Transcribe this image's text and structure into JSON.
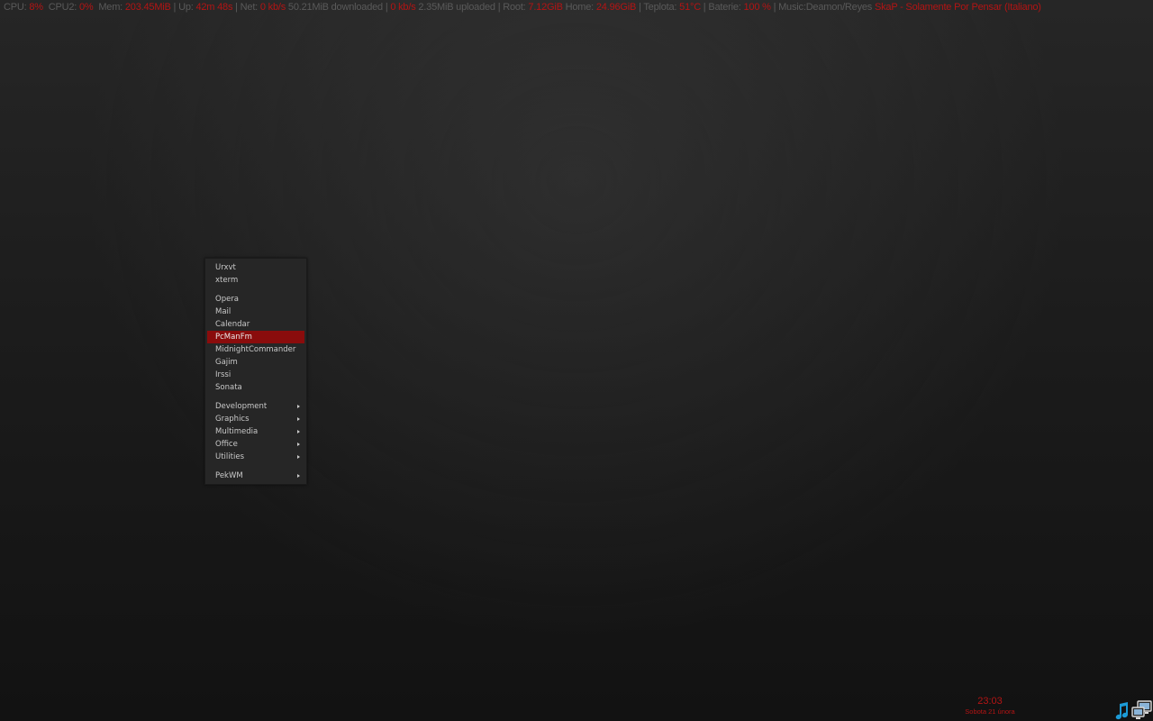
{
  "statusbar": {
    "cpu_label": "CPU:",
    "cpu_value": "8%",
    "cpu2_label": "CPU2:",
    "cpu2_value": "0%",
    "mem_label": "Mem:",
    "mem_value": "203.45MiB",
    "uptime_label": "Up:",
    "uptime_value": "42m 48s",
    "net_label": "Net:",
    "down_speed": "0 kb/s",
    "downloaded": "50.21MiB downloaded",
    "up_speed": "0 kb/s",
    "uploaded": "2.35MiB uploaded",
    "root_label": "Root:",
    "root_value": "7.12GiB",
    "home_label": "Home:",
    "home_value": "24.96GiB",
    "temp_label": "Teplota:",
    "temp_value": "51°C",
    "battery_label": "Baterie:",
    "battery_value": "100 %",
    "music_label": "Music:",
    "music_artist": "Deamon/Reyes",
    "music_track": "SkaP - Solamente Por Pensar (Italiano)",
    "separator": "|"
  },
  "menu": {
    "groups": [
      [
        {
          "label": "Urxvt",
          "submenu": false,
          "active": false
        },
        {
          "label": "xterm",
          "submenu": false,
          "active": false
        }
      ],
      [
        {
          "label": "Opera",
          "submenu": false,
          "active": false
        },
        {
          "label": "Mail",
          "submenu": false,
          "active": false
        },
        {
          "label": "Calendar",
          "submenu": false,
          "active": false
        },
        {
          "label": "PcManFm",
          "submenu": false,
          "active": true
        },
        {
          "label": "MidnightCommander",
          "submenu": false,
          "active": false
        },
        {
          "label": "Gajim",
          "submenu": false,
          "active": false
        },
        {
          "label": "Irssi",
          "submenu": false,
          "active": false
        },
        {
          "label": "Sonata",
          "submenu": false,
          "active": false
        }
      ],
      [
        {
          "label": "Development",
          "submenu": true,
          "active": false
        },
        {
          "label": "Graphics",
          "submenu": true,
          "active": false
        },
        {
          "label": "Multimedia",
          "submenu": true,
          "active": false
        },
        {
          "label": "Office",
          "submenu": true,
          "active": false
        },
        {
          "label": "Utilities",
          "submenu": true,
          "active": false
        }
      ],
      [
        {
          "label": "PekWM",
          "submenu": true,
          "active": false
        }
      ]
    ]
  },
  "clock": {
    "time": "23:03",
    "date": "Sobota 21 února"
  },
  "tray": {
    "icons": [
      "music-note-icon",
      "network-computer-icon"
    ]
  },
  "colors": {
    "accent": "#b31414",
    "menu_bg": "#262626",
    "menu_active": "#8a0c0c",
    "menu_text": "#c9c9c9",
    "label_grey": "#5a5a5a",
    "tray_blue": "#1c9ad6"
  }
}
